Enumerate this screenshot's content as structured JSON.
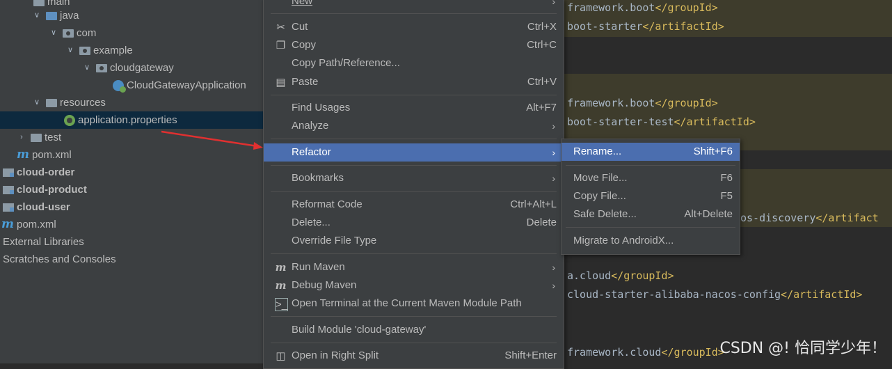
{
  "tree": {
    "items": [
      {
        "label": "main",
        "indent": 2
      },
      {
        "label": "java",
        "indent": 3
      },
      {
        "label": "com",
        "indent": 4
      },
      {
        "label": "example",
        "indent": 5
      },
      {
        "label": "cloudgateway",
        "indent": 6
      },
      {
        "label": "CloudGatewayApplication",
        "indent": 7
      },
      {
        "label": "resources",
        "indent": 3
      },
      {
        "label": "application.properties",
        "indent": 4
      },
      {
        "label": "test",
        "indent": 2
      },
      {
        "label": "pom.xml",
        "indent": 1
      },
      {
        "label": "cloud-order",
        "indent": 0
      },
      {
        "label": "cloud-product",
        "indent": 0
      },
      {
        "label": "cloud-user",
        "indent": 0
      },
      {
        "label": "pom.xml",
        "indent": 0
      },
      {
        "label": "External Libraries",
        "indent": 0
      },
      {
        "label": "Scratches and Consoles",
        "indent": 0
      }
    ]
  },
  "editor": {
    "lines": [
      {
        "pre": "framework.boot",
        "tag": "</groupId>"
      },
      {
        "pre": "boot-starter",
        "tag": "</artifactId>"
      },
      {
        "pre": "framework.boot",
        "tag": "</groupId>"
      },
      {
        "pre": "boot-starter-test",
        "tag": "</artifactId>"
      },
      {
        "pre": "os-discovery",
        "tag": "</artifact"
      },
      {
        "pre": "a.cloud",
        "tag": "</groupId>"
      },
      {
        "pre": "cloud-starter-alibaba-nacos-config",
        "tag": "</artifactId>"
      },
      {
        "pre": "framework.cloud",
        "tag": "</groupId>"
      }
    ]
  },
  "context_menu": {
    "new": "New",
    "cut": "Cut",
    "cut_sc": "Ctrl+X",
    "copy": "Copy",
    "copy_sc": "Ctrl+C",
    "copy_path": "Copy Path/Reference...",
    "paste": "Paste",
    "paste_sc": "Ctrl+V",
    "find_usages": "Find Usages",
    "find_usages_sc": "Alt+F7",
    "analyze": "Analyze",
    "refactor": "Refactor",
    "bookmarks": "Bookmarks",
    "reformat": "Reformat Code",
    "reformat_sc": "Ctrl+Alt+L",
    "delete": "Delete...",
    "delete_sc": "Delete",
    "override": "Override File Type",
    "run_maven": "Run Maven",
    "debug_maven": "Debug Maven",
    "open_terminal": "Open Terminal at the Current Maven Module Path",
    "build_module": "Build Module 'cloud-gateway'",
    "open_right": "Open in Right Split",
    "open_right_sc": "Shift+Enter"
  },
  "submenu": {
    "rename": "Rename...",
    "rename_sc": "Shift+F6",
    "move": "Move File...",
    "move_sc": "F6",
    "copy_file": "Copy File...",
    "copy_file_sc": "F5",
    "safe_delete": "Safe Delete...",
    "safe_delete_sc": "Alt+Delete",
    "migrate": "Migrate to AndroidX..."
  },
  "watermark": "CSDN @! 恰同学少年！",
  "colors": {
    "highlight": "#4b6eaf",
    "annotation_arrow": "#e03030"
  }
}
